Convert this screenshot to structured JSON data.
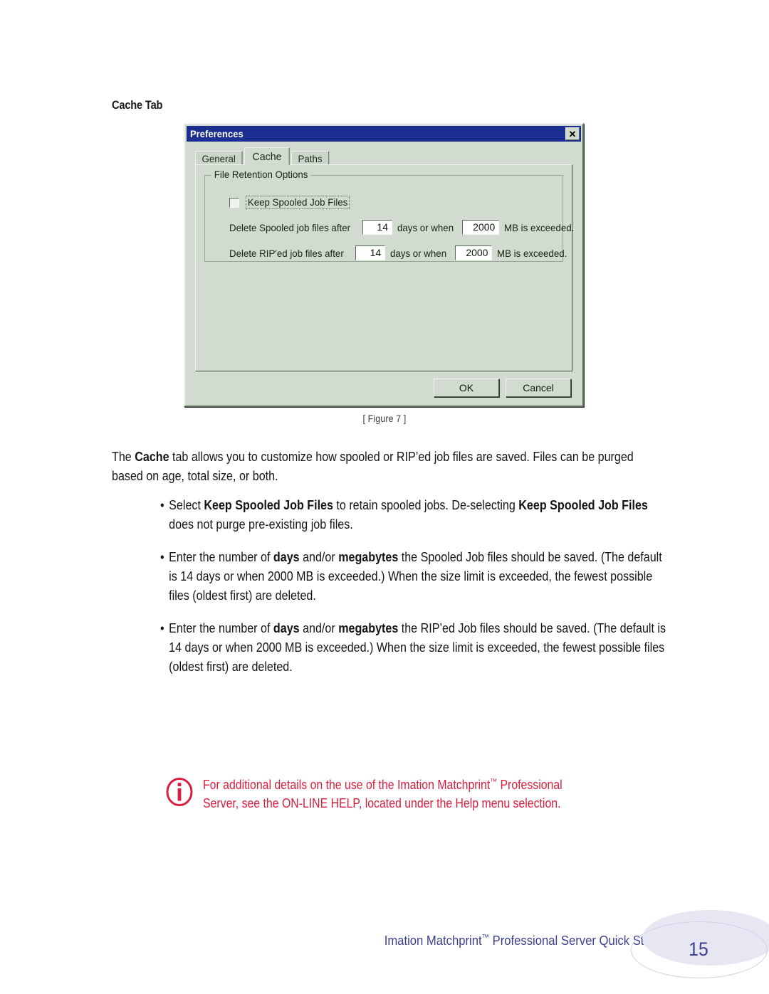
{
  "page": {
    "heading": "Cache Tab",
    "figure_caption": "[ Figure 7 ]",
    "background": "#ffffff"
  },
  "dialog": {
    "title": "Preferences",
    "close_label": "✕",
    "colors": {
      "titlebar": "#1c2f91",
      "face": "#d2dbd0",
      "text": "#16240f"
    },
    "tabs": [
      {
        "label": "General",
        "active": false
      },
      {
        "label": "Cache",
        "active": true
      },
      {
        "label": "Paths",
        "active": false
      }
    ],
    "group": {
      "label": "File Retention Options",
      "checkbox": {
        "label": "Keep Spooled Job Files",
        "checked": false
      },
      "rows": [
        {
          "prefix": "Delete Spooled job files after",
          "days_value": "14",
          "middle": "days or when",
          "mb_value": "2000",
          "suffix": "MB is exceeded."
        },
        {
          "prefix": "Delete RIP'ed job files after",
          "days_value": "14",
          "middle": "days or when",
          "mb_value": "2000",
          "suffix": "MB is exceeded."
        }
      ]
    },
    "buttons": {
      "ok": "OK",
      "cancel": "Cancel"
    }
  },
  "body": {
    "intro_line1_pre": "The ",
    "intro_line1_bold": "Cache",
    "intro_line1_post": " tab allows you to customize how spooled or RIP’ed job files are saved. Files can be purged based on age, total size, or both.",
    "bullets": [
      {
        "segments": [
          {
            "text": "Select ",
            "bold": false
          },
          {
            "text": "Keep Spooled Job Files",
            "bold": true
          },
          {
            "text": " to retain spooled jobs. De-selecting ",
            "bold": false
          },
          {
            "text": "Keep Spooled Job Files",
            "bold": true
          },
          {
            "text": " does not purge pre-existing job files.",
            "bold": false
          }
        ]
      },
      {
        "segments": [
          {
            "text": "Enter the number of ",
            "bold": false
          },
          {
            "text": "days",
            "bold": true
          },
          {
            "text": " and/or ",
            "bold": false
          },
          {
            "text": "megabytes",
            "bold": true
          },
          {
            "text": " the Spooled Job files should be saved. (The default is 14 days or when 2000 MB is exceeded.) When the size limit is exceeded, the fewest possible files (oldest first) are deleted.",
            "bold": false
          }
        ]
      },
      {
        "segments": [
          {
            "text": "Enter the number of ",
            "bold": false
          },
          {
            "text": "days",
            "bold": true
          },
          {
            "text": " and/or ",
            "bold": false
          },
          {
            "text": "megabytes",
            "bold": true
          },
          {
            "text": " the RIP’ed Job files should be saved. (The default is 14 days or when 2000 MB is exceeded.) When the size limit is exceeded, the fewest possible files (oldest first) are deleted.",
            "bold": false
          }
        ]
      }
    ]
  },
  "note": {
    "icon": "info-icon",
    "color": "#d81e3f",
    "line1_a": "For additional details on the use of the Imation Matchprint",
    "line1_tm": "™",
    "line1_b": " Professional",
    "line2": "Server, see the ON-LINE HELP, located under the Help menu selection."
  },
  "footer": {
    "text_a": "Imation Matchprint",
    "text_tm": "™",
    "text_b": " Professional Server Quick Start",
    "page_number": "15",
    "color": "#3b3f8f"
  }
}
